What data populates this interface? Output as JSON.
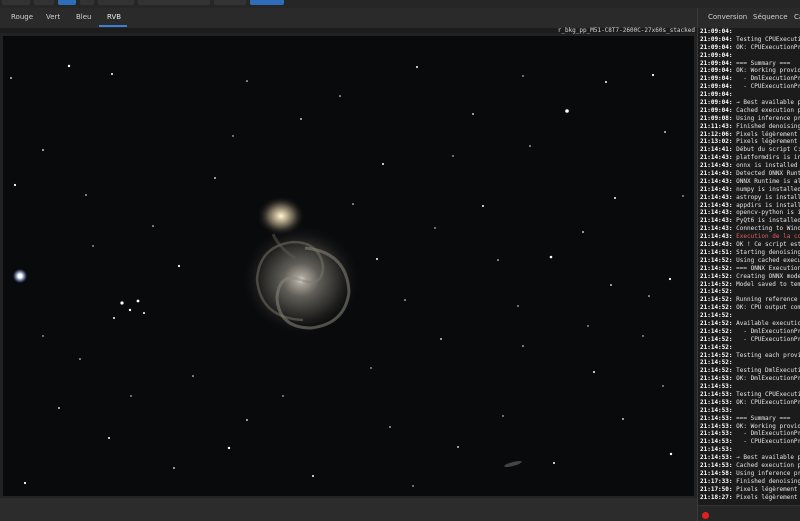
{
  "channel_tabs": [
    "Rouge",
    "Vert",
    "Bleu",
    "RVB"
  ],
  "active_channel": "RVB",
  "file_name": "r_bkg_pp_M51-C8T7-2600C-27x60s_stacked",
  "panel_tabs": [
    "Conversion",
    "Séquence",
    "Ca"
  ],
  "colors": {
    "accent": "#3d7fd0",
    "error_text": "#e06060",
    "status_dot": "#e02020",
    "sky": "#090a0c"
  },
  "log": [
    {
      "t": "21:09:04:",
      "m": ""
    },
    {
      "t": "21:09:04:",
      "m": " Testing CPUExecution"
    },
    {
      "t": "21:09:04:",
      "m": " OK: CPUExecutionProv"
    },
    {
      "t": "21:09:04:",
      "m": ""
    },
    {
      "t": "21:09:04:",
      "m": " === Summary ==="
    },
    {
      "t": "21:09:04:",
      "m": " OK: Working provider"
    },
    {
      "t": "21:09:04:",
      "m": "   - DmlExecutionProv"
    },
    {
      "t": "21:09:04:",
      "m": "   - CPUExecutionProv"
    },
    {
      "t": "21:09:04:",
      "m": ""
    },
    {
      "t": "21:09:04:",
      "m": " → Best available pro"
    },
    {
      "t": "21:09:04:",
      "m": " Cached execution pro"
    },
    {
      "t": "21:09:08:",
      "m": " Using inference prov"
    },
    {
      "t": "21:11:43:",
      "m": " Finished denoising"
    },
    {
      "t": "21:12:06:",
      "m": " Pixels légèrement ha"
    },
    {
      "t": "21:13:02:",
      "m": " Pixels légèrement ha"
    },
    {
      "t": "21:14:41:",
      "m": " Début du script C:\\"
    },
    {
      "t": "21:14:43:",
      "m": " platformdirs is inst"
    },
    {
      "t": "21:14:43:",
      "m": " onnx is installed"
    },
    {
      "t": "21:14:43:",
      "m": " Detected ONNX Runtim"
    },
    {
      "t": "21:14:43:",
      "m": " ONNX Runtime is alre"
    },
    {
      "t": "21:14:43:",
      "m": " numpy is installed"
    },
    {
      "t": "21:14:43:",
      "m": " astropy is installed"
    },
    {
      "t": "21:14:43:",
      "m": " appdirs is installed"
    },
    {
      "t": "21:14:43:",
      "m": " opencv-python is ins"
    },
    {
      "t": "21:14:43:",
      "m": " PyQt6 is installed"
    },
    {
      "t": "21:14:43:",
      "m": " Connecting to Window"
    },
    {
      "t": "21:14:43:",
      "m": " Execution de la comm",
      "err": true
    },
    {
      "t": "21:14:43:",
      "m": " OK ! Ce script est c"
    },
    {
      "t": "21:14:51:",
      "m": " Starting denoising"
    },
    {
      "t": "21:14:52:",
      "m": " Using cached executi"
    },
    {
      "t": "21:14:52:",
      "m": " === ONNX Execution P"
    },
    {
      "t": "21:14:52:",
      "m": " Creating ONNX model"
    },
    {
      "t": "21:14:52:",
      "m": " Model saved to tempo"
    },
    {
      "t": "21:14:52:",
      "m": ""
    },
    {
      "t": "21:14:52:",
      "m": " Running reference on"
    },
    {
      "t": "21:14:52:",
      "m": " OK: CPU output compu"
    },
    {
      "t": "21:14:52:",
      "m": ""
    },
    {
      "t": "21:14:52:",
      "m": " Available execution"
    },
    {
      "t": "21:14:52:",
      "m": "   - DmlExecutionProv"
    },
    {
      "t": "21:14:52:",
      "m": "   - CPUExecutionProv"
    },
    {
      "t": "21:14:52:",
      "m": ""
    },
    {
      "t": "21:14:52:",
      "m": " Testing each provide"
    },
    {
      "t": "21:14:52:",
      "m": ""
    },
    {
      "t": "21:14:52:",
      "m": " Testing DmlExecution"
    },
    {
      "t": "21:14:53:",
      "m": " OK: DmlExecutionProv"
    },
    {
      "t": "21:14:53:",
      "m": ""
    },
    {
      "t": "21:14:53:",
      "m": " Testing CPUExecution"
    },
    {
      "t": "21:14:53:",
      "m": " OK: CPUExecutionProv"
    },
    {
      "t": "21:14:53:",
      "m": ""
    },
    {
      "t": "21:14:53:",
      "m": " === Summary ==="
    },
    {
      "t": "21:14:53:",
      "m": " OK: Working provider"
    },
    {
      "t": "21:14:53:",
      "m": "   - DmlExecutionProv"
    },
    {
      "t": "21:14:53:",
      "m": "   - CPUExecutionProv"
    },
    {
      "t": "21:14:53:",
      "m": ""
    },
    {
      "t": "21:14:53:",
      "m": " → Best available pro"
    },
    {
      "t": "21:14:53:",
      "m": " Cached execution pro"
    },
    {
      "t": "21:14:58:",
      "m": " Using inference prov"
    },
    {
      "t": "21:17:33:",
      "m": " Finished denoising"
    },
    {
      "t": "21:17:50:",
      "m": " Pixels légèrement ha"
    },
    {
      "t": "21:18:27:",
      "m": " Pixels légèrement ha"
    }
  ]
}
